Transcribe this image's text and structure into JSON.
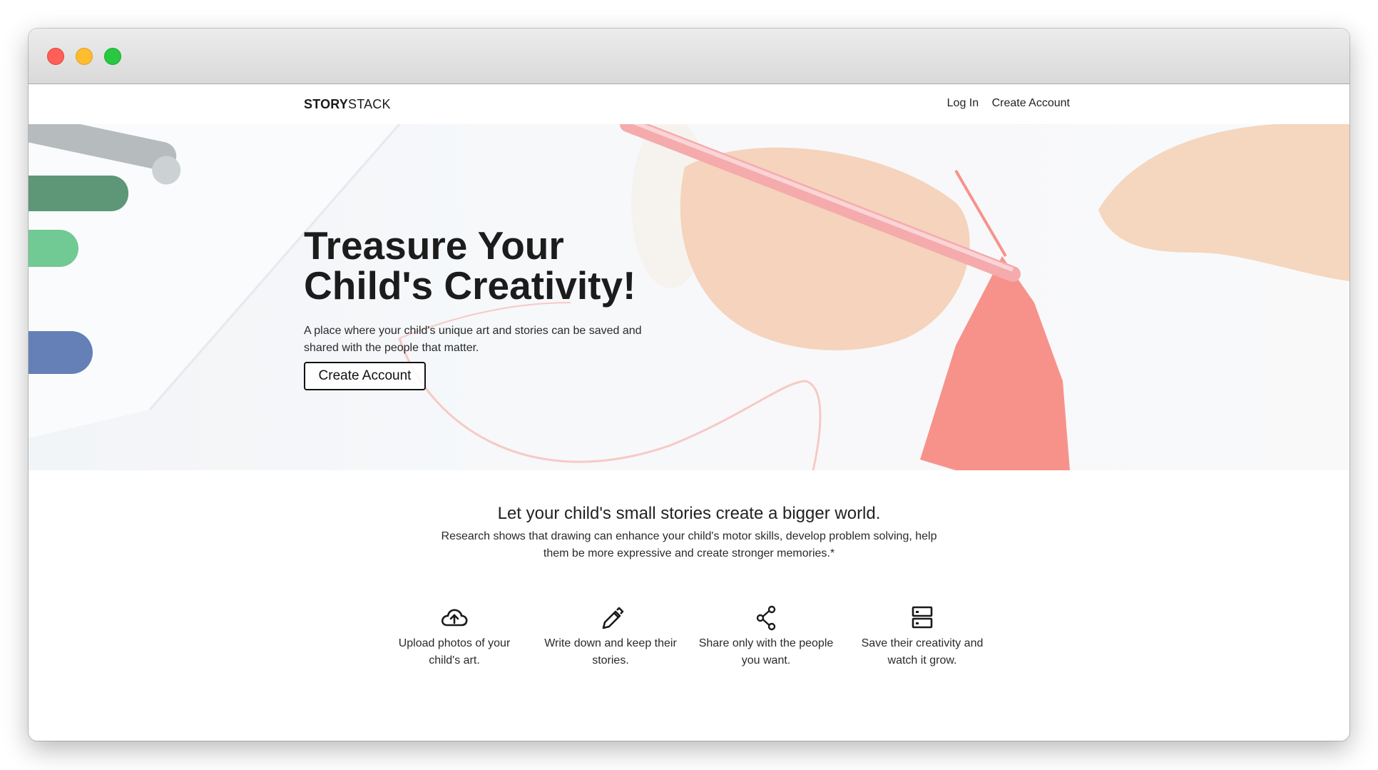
{
  "brand": {
    "bold": "STORY",
    "regular": "STACK"
  },
  "nav": {
    "login": "Log In",
    "create_account": "Create Account"
  },
  "hero": {
    "title": "Treasure Your Child's Creativity!",
    "subtitle": "A place where your child's unique art and stories can be saved and shared with the people that matter.",
    "button": "Create Account"
  },
  "section": {
    "tagline": "Let your child's small stories create a bigger world.",
    "description": "Research shows that drawing can enhance your child's motor skills, develop problem solving, help them be more expressive and create stronger memories.*"
  },
  "features": [
    {
      "icon": "cloud-upload-icon",
      "text": "Upload photos of your child's art."
    },
    {
      "icon": "pencil-icon",
      "text": "Write down and keep their stories."
    },
    {
      "icon": "share-icon",
      "text": "Share only with the people you want."
    },
    {
      "icon": "storage-icon",
      "text": "Save their creativity and watch it grow."
    }
  ],
  "colors": {
    "accent_red": "#f4695f",
    "text": "#222222",
    "window_close": "#fe5f57",
    "window_minimize": "#febc2e",
    "window_zoom": "#28c840"
  }
}
